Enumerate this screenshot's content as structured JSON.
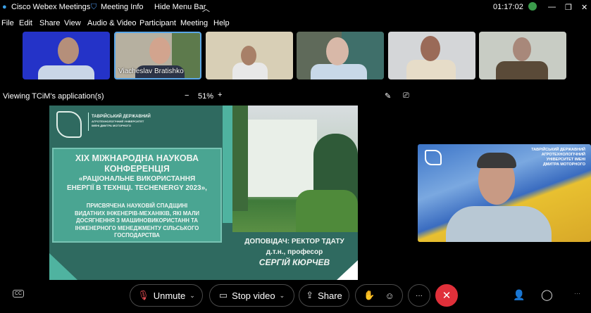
{
  "titlebar": {
    "app": "Cisco Webex Meetings",
    "meeting_info": "Meeting Info",
    "hide_menu": "Hide Menu Bar",
    "time": "01:17:02"
  },
  "menu": [
    "File",
    "Edit",
    "Share",
    "View",
    "Audio & Video",
    "Participant",
    "Meeting",
    "Help"
  ],
  "participants": [
    {
      "name": ""
    },
    {
      "name": "Viacheslav Bratishko"
    },
    {
      "name": ""
    },
    {
      "name": ""
    },
    {
      "name": ""
    },
    {
      "name": ""
    }
  ],
  "viewbar": {
    "label": "Viewing TCiM's application(s)",
    "zoom": "51%",
    "minus": "−",
    "plus": "+"
  },
  "slide": {
    "university": "ТАВРІЙСЬКИЙ ДЕРЖАВНИЙ",
    "university_sub1": "АГРОТЕХНОЛОГІЧНИЙ УНІВЕРСИТЕТ",
    "university_sub2": "ІМЕНІ ДМИТРА МОТОРНОГО",
    "title1": "XIX МІЖНАРОДНА НАУКОВА",
    "title2": "КОНФЕРЕНЦІЯ",
    "title3": "«РАЦІОНАЛЬНЕ ВИКОРИСТАННЯ",
    "title4": "ЕНЕРГІЇ В ТЕХНІЦІ. TECHENERGY 2023»,",
    "desc1": "ПРИСВЯЧЕНА НАУКОВІЙ СПАДЩИНІ",
    "desc2": "ВИДАТНИХ ІНЖЕНЕРІВ-МЕХАНІКІВ, ЯКІ МАЛИ",
    "desc3": "ДОСЯГНЕННЯ З МАШИНОВИКОРИСТАНН ТА",
    "desc4": "ІНЖЕНЕРНОГО МЕНЕДЖМЕНТУ СІЛЬСЬКОГО",
    "desc5": "ГОСПОДАРСТВА",
    "speaker1": "ДОПОВІДАЧ: РЕКТОР ТДАТУ",
    "speaker2": "д.т.н., професор",
    "speaker3": "СЕРГІЙ КЮРЧЕВ"
  },
  "speaker_video": {
    "bg_text1": "ТАВРІЙСЬКИЙ ДЕРЖАВНИЙ",
    "bg_text2": "АГРОТЕХНОЛОГІЧНИЙ",
    "bg_text3": "УНІВЕРСИТЕТ ІМЕНІ",
    "bg_text4": "ДМИТРА МОТОРНОГО"
  },
  "controls": {
    "unmute": "Unmute",
    "stop_video": "Stop video",
    "share": "Share",
    "more": "···",
    "end": "✕"
  },
  "colors": {
    "slide_dark": "#2f6a60",
    "slide_light": "#4fb3a0",
    "end_red": "#e0303a",
    "active_border": "#5aa7e8"
  }
}
